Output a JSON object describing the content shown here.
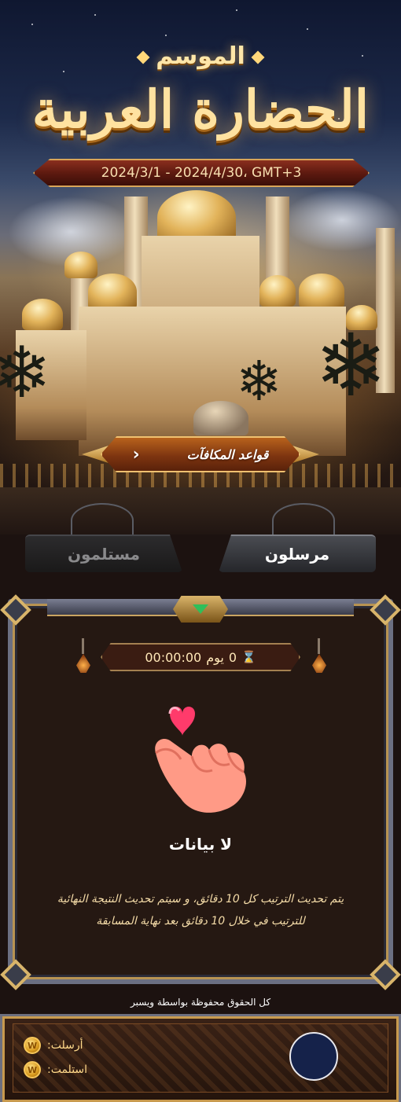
{
  "hero": {
    "season_label": "الموسم",
    "title": "الحضارة العربية",
    "date_range": "2024/3/1 - 2024/4/30، GMT+3"
  },
  "rewards_button": {
    "label": "قواعد المكافآت"
  },
  "tabs": [
    {
      "label": "مرسلون",
      "active": true
    },
    {
      "label": "مستلمون",
      "active": false
    }
  ],
  "timer": {
    "days_value": "0",
    "days_unit": "يوم",
    "time": "00:00:00",
    "icon": "hourglass-icon"
  },
  "empty_state": {
    "icon": "heart-hand-icon",
    "title": "لا بيانات",
    "note": "يتم تحديث الترتيب كل 10 دقائق، و سيتم تحديث النتيجة النهائية للترتيب في خلال 10 دقائق بعد نهاية المسابقة"
  },
  "footer": {
    "copyright": "كل الحقوق محفوظة بواسطة ويسبر"
  },
  "bottom_bar": {
    "sent_label": "أرسلت:",
    "received_label": "استلمت:",
    "coin_icon": "coin-icon"
  },
  "colors": {
    "accent_gold": "#f0c170",
    "panel_bg": "#251812",
    "page_bg": "#1c1210"
  }
}
